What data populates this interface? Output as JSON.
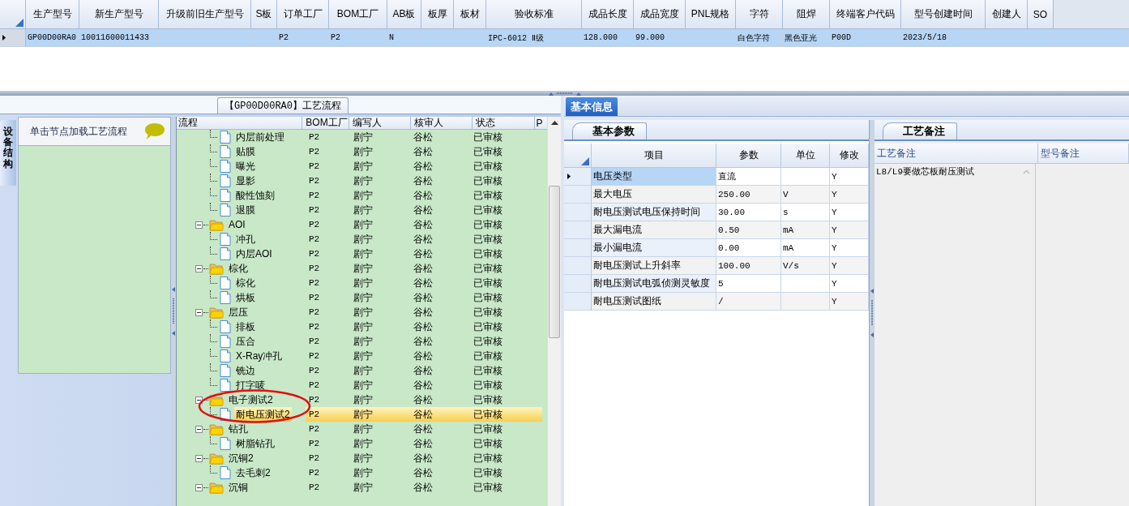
{
  "main_grid": {
    "columns": [
      "生产型号",
      "新生产型号",
      "升级前旧生产型号",
      "S板",
      "订单工厂",
      "BOM工厂",
      "AB板",
      "板厚",
      "板材",
      "验收标准",
      "成品长度",
      "成品宽度",
      "PNL规格",
      "字符",
      "阻焊",
      "终端客户代码",
      "型号创建时间",
      "创建人",
      "SO"
    ],
    "rows": [
      {
        "selected": true,
        "cells": [
          "GP00D00RA0",
          "10011600011433",
          null,
          null,
          "P2",
          "P2",
          "N",
          null,
          null,
          "IPC-6012 Ⅱ级",
          "128.000",
          "99.000",
          null,
          "白色字符",
          "黑色亚光",
          "P00D",
          "2023/5/18",
          null,
          null
        ]
      }
    ]
  },
  "flow_tab": {
    "title": "【GP00D00RA0】工艺流程"
  },
  "side_tab": {
    "label": "设备结构"
  },
  "node_panel": {
    "hint": "单击节点加载工艺流程"
  },
  "flow_tree": {
    "columns": [
      "流程",
      "BOM工厂",
      "编写人",
      "核审人",
      "状态",
      "P"
    ],
    "nodes": [
      {
        "children": [
          {
            "kind": "file",
            "name": "内层前处理",
            "bom": "P2",
            "writer": "剧宁",
            "reviewer": "谷松",
            "status": "已审核",
            "selected": false
          },
          {
            "kind": "file",
            "name": "贴膜",
            "bom": "P2",
            "writer": "剧宁",
            "reviewer": "谷松",
            "status": "已审核",
            "selected": false
          },
          {
            "kind": "file",
            "name": "曝光",
            "bom": "P2",
            "writer": "剧宁",
            "reviewer": "谷松",
            "status": "已审核",
            "selected": false
          },
          {
            "kind": "file",
            "name": "显影",
            "bom": "P2",
            "writer": "剧宁",
            "reviewer": "谷松",
            "status": "已审核",
            "selected": false
          },
          {
            "kind": "file",
            "name": "酸性蚀刻",
            "bom": "P2",
            "writer": "剧宁",
            "reviewer": "谷松",
            "status": "已审核",
            "selected": false
          },
          {
            "kind": "file",
            "name": "退膜",
            "bom": "P2",
            "writer": "剧宁",
            "reviewer": "谷松",
            "status": "已审核",
            "selected": false
          }
        ]
      },
      {
        "kind": "folder",
        "name": "AOI",
        "bom": "P2",
        "writer": "剧宁",
        "reviewer": "谷松",
        "status": "已审核",
        "selected": false,
        "expanded": true,
        "children": [
          {
            "kind": "file",
            "name": "冲孔",
            "bom": "P2",
            "writer": "剧宁",
            "reviewer": "谷松",
            "status": "已审核",
            "selected": false
          },
          {
            "kind": "file",
            "name": "内层AOI",
            "bom": "P2",
            "writer": "剧宁",
            "reviewer": "谷松",
            "status": "已审核",
            "selected": false
          }
        ]
      },
      {
        "kind": "folder",
        "name": "棕化",
        "bom": "P2",
        "writer": "剧宁",
        "reviewer": "谷松",
        "status": "已审核",
        "selected": false,
        "expanded": true,
        "children": [
          {
            "kind": "file",
            "name": "棕化",
            "bom": "P2",
            "writer": "剧宁",
            "reviewer": "谷松",
            "status": "已审核",
            "selected": false
          },
          {
            "kind": "file",
            "name": "烘板",
            "bom": "P2",
            "writer": "剧宁",
            "reviewer": "谷松",
            "status": "已审核",
            "selected": false
          }
        ]
      },
      {
        "kind": "folder",
        "name": "层压",
        "bom": "P2",
        "writer": "剧宁",
        "reviewer": "谷松",
        "status": "已审核",
        "selected": false,
        "expanded": true,
        "children": [
          {
            "kind": "file",
            "name": "排板",
            "bom": "P2",
            "writer": "剧宁",
            "reviewer": "谷松",
            "status": "已审核",
            "selected": false
          },
          {
            "kind": "file",
            "name": "压合",
            "bom": "P2",
            "writer": "剧宁",
            "reviewer": "谷松",
            "status": "已审核",
            "selected": false
          },
          {
            "kind": "file",
            "name": "X-Ray冲孔",
            "bom": "P2",
            "writer": "剧宁",
            "reviewer": "谷松",
            "status": "已审核",
            "selected": false
          },
          {
            "kind": "file",
            "name": "铣边",
            "bom": "P2",
            "writer": "剧宁",
            "reviewer": "谷松",
            "status": "已审核",
            "selected": false
          },
          {
            "kind": "file",
            "name": "打字唛",
            "bom": "P2",
            "writer": "剧宁",
            "reviewer": "谷松",
            "status": "已审核",
            "selected": false
          }
        ]
      },
      {
        "kind": "folder",
        "name": "电子测试2",
        "bom": "P2",
        "writer": "剧宁",
        "reviewer": "谷松",
        "status": "已审核",
        "selected": false,
        "expanded": true,
        "children": [
          {
            "kind": "file",
            "name": "耐电压测试2",
            "bom": "P2",
            "writer": "剧宁",
            "reviewer": "谷松",
            "status": "已审核",
            "selected": true
          }
        ]
      },
      {
        "kind": "folder",
        "name": "钻孔",
        "bom": "P2",
        "writer": "剧宁",
        "reviewer": "谷松",
        "status": "已审核",
        "selected": false,
        "expanded": true,
        "children": [
          {
            "kind": "file",
            "name": "树脂钻孔",
            "bom": "P2",
            "writer": "剧宁",
            "reviewer": "谷松",
            "status": "已审核",
            "selected": false
          }
        ]
      },
      {
        "kind": "folder",
        "name": "沉铜2",
        "bom": "P2",
        "writer": "剧宁",
        "reviewer": "谷松",
        "status": "已审核",
        "selected": false,
        "expanded": true,
        "children": [
          {
            "kind": "file",
            "name": "去毛刺2",
            "bom": "P2",
            "writer": "剧宁",
            "reviewer": "谷松",
            "status": "已审核",
            "selected": false
          }
        ]
      },
      {
        "kind": "folder",
        "name": "沉铜",
        "bom": "P2",
        "writer": "剧宁",
        "reviewer": "谷松",
        "status": "已审核",
        "selected": false,
        "expanded": true
      }
    ]
  },
  "info_tabs": [
    {
      "label": "基本信息",
      "selected": true
    }
  ],
  "param_panel": {
    "tab": "基本参数",
    "columns": [
      "项目",
      "参数",
      "单位",
      "修改"
    ],
    "rows": [
      {
        "selected": true,
        "cells": [
          "电压类型",
          "直流",
          null,
          "Y"
        ]
      },
      {
        "selected": false,
        "cells": [
          "最大电压",
          "250.00",
          "V",
          "Y"
        ]
      },
      {
        "selected": false,
        "cells": [
          "耐电压测试电压保持时间",
          "30.00",
          "s",
          "Y"
        ]
      },
      {
        "selected": false,
        "cells": [
          "最大漏电流",
          "0.50",
          "mA",
          "Y"
        ]
      },
      {
        "selected": false,
        "cells": [
          "最小漏电流",
          "0.00",
          "mA",
          "Y"
        ]
      },
      {
        "selected": false,
        "cells": [
          "耐电压测试上升斜率",
          "100.00",
          "V/s",
          "Y"
        ]
      },
      {
        "selected": false,
        "cells": [
          "耐电压测试电弧侦测灵敏度",
          "5",
          null,
          "Y"
        ]
      },
      {
        "selected": false,
        "cells": [
          "耐电压测试图纸",
          "/",
          null,
          "Y"
        ]
      }
    ]
  },
  "notes_panel": {
    "tab": "工艺备注",
    "columns": [
      "工艺备注",
      "型号备注"
    ],
    "rows": [
      [
        "L8/L9要做芯板耐压测试"
      ]
    ]
  }
}
